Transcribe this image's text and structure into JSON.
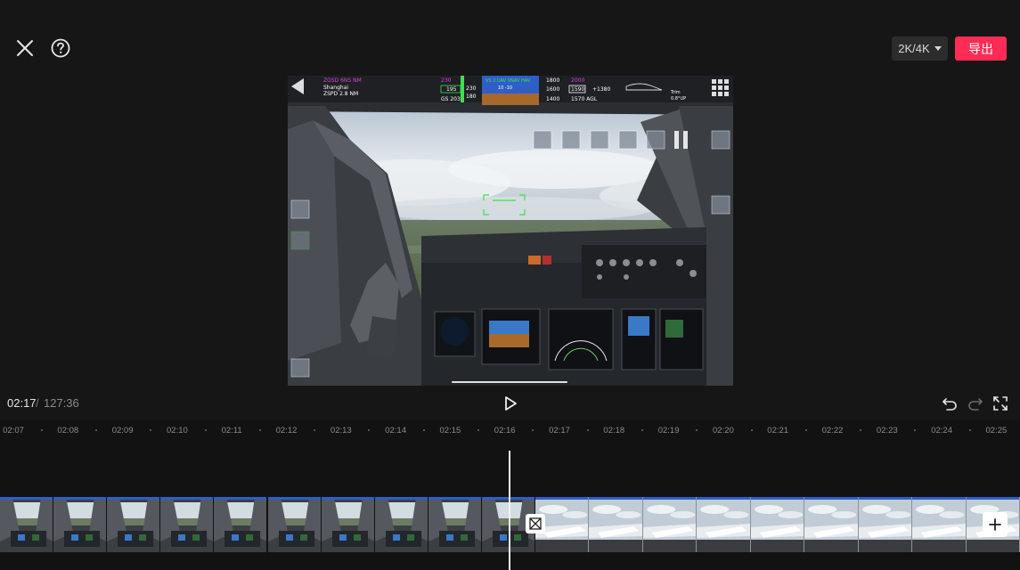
{
  "toolbar": {
    "close_icon": "close-icon",
    "help_icon": "help-icon",
    "resolution_label": "2K/4K",
    "export_label": "导出"
  },
  "preview": {
    "hud": {
      "route_top": "ZGSD 6NS NM",
      "route_city": "Shanghai",
      "route_dist": "ZSPD 2.8 NM",
      "speed_top": "230",
      "speed_mid": "195",
      "speed_bottom": "180",
      "ground_speed": "GS 203",
      "fma_top": "VS 2 UAV VNAV HAV",
      "fma_mid": "10 -10",
      "alt_top": "1800",
      "alt_mid": "1600",
      "alt_bottom": "1400",
      "alt_target": "2000",
      "alt_current": "1590",
      "vs_value": "+1380",
      "agl": "1570 AGL",
      "trim_label": "Trim",
      "trim_value": "0.8°UP"
    },
    "progress": 0.26
  },
  "playback": {
    "current_time": "02:17",
    "separator": "/",
    "total_time": "127:36"
  },
  "timeline": {
    "ruler_labels": [
      "02:07",
      "02:08",
      "02:09",
      "02:10",
      "02:11",
      "02:12",
      "02:13",
      "02:14",
      "02:15",
      "02:16",
      "02:17",
      "02:18",
      "02:19",
      "02:20",
      "02:21",
      "02:22",
      "02:23",
      "02:24",
      "02:25"
    ],
    "clip_a_frames": 10,
    "clip_b_frames": 9
  },
  "colors": {
    "background": "#161616",
    "accent": "#fe2c55",
    "sky": "#c9d3dc",
    "ground": "#4a5a3c",
    "cockpit": "#2a2d31",
    "hud_magenta": "#e040e0",
    "hud_green": "#3ce24a"
  }
}
